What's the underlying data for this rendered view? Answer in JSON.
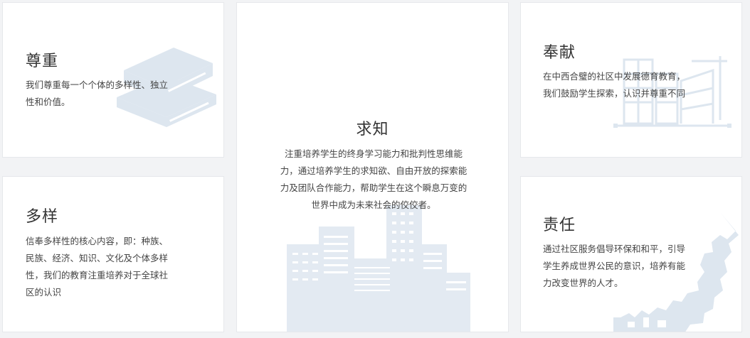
{
  "cards": {
    "respect": {
      "title": "尊重",
      "text": "我们尊重每一个个体的多样性、独立性和价值。",
      "icon": "books-icon"
    },
    "diversity": {
      "title": "多样",
      "text": "信奉多样性的核心内容，即：种族、民族、经济、知识、文化及个体多样性，我们的教育注重培养对于全球社区的认识"
    },
    "knowledge": {
      "title": "求知",
      "text": "注重培养学生的终身学习能力和批判性思维能力，通过培养学生的求知欲、自由开放的探索能力及团队合作能力，帮助学生在这个瞬息万变的世界中成为未来社会的佼佼者。",
      "icon": "city-buildings-icon"
    },
    "contribution": {
      "title": "奉献",
      "text": "在中西合璧的社区中发展德育教育，我们鼓励学生探索，认识并尊重不同",
      "icon": "blueprint-building-icon"
    },
    "responsibility": {
      "title": "责任",
      "text": "通过社区服务倡导环保和和平，引导学生养成世界公民的意识，培养有能力改变世界的人才。",
      "icon": "map-icon"
    }
  },
  "colors": {
    "background": "#f2f3f5",
    "card": "#ffffff",
    "decoration": "#dde6ef",
    "title": "#333333",
    "body_text": "#444444"
  }
}
